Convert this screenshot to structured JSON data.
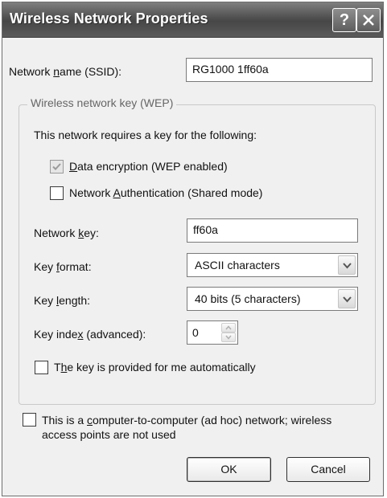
{
  "window": {
    "title": "Wireless Network Properties",
    "help_label": "?"
  },
  "network_name": {
    "label_pre": "Network ",
    "label_key": "n",
    "label_post": "ame (SSID):",
    "value": "RG1000 1ff60a"
  },
  "wep_group": {
    "legend": "Wireless network key (WEP)",
    "requires_text": "This network requires a key for the following:",
    "data_encryption": {
      "checked": true,
      "label_key": "D",
      "label_post": "ata encryption (WEP enabled)"
    },
    "network_auth": {
      "checked": false,
      "label_pre": "Network ",
      "label_key": "A",
      "label_post": "uthentication (Shared mode)"
    },
    "network_key": {
      "label_pre": "Network ",
      "label_key": "k",
      "label_post": "ey:",
      "value": "ff60a"
    },
    "key_format": {
      "label_pre": "Key ",
      "label_key": "f",
      "label_post": "ormat:",
      "selected": "ASCII characters"
    },
    "key_length": {
      "label_pre": "Key ",
      "label_key": "l",
      "label_post": "ength:",
      "selected": "40 bits (5 characters)"
    },
    "key_index": {
      "label_pre": "Key inde",
      "label_key": "x",
      "label_post": " (advanced):",
      "value": "0"
    },
    "auto_key": {
      "checked": false,
      "label_pre": "T",
      "label_key": "h",
      "label_post": "e key is provided for me automatically"
    }
  },
  "adhoc": {
    "checked": false,
    "line1_pre": "This is a ",
    "line1_key": "c",
    "line1_post": "omputer-to-computer (ad hoc) network; wireless",
    "line2": "access points are not used"
  },
  "buttons": {
    "ok": "OK",
    "cancel": "Cancel"
  },
  "icons": {
    "help": "help-icon",
    "close": "close-icon",
    "check": "checkmark-icon",
    "dropdown": "chevron-down-icon",
    "spin_up": "spin-up-icon",
    "spin_down": "spin-down-icon"
  }
}
